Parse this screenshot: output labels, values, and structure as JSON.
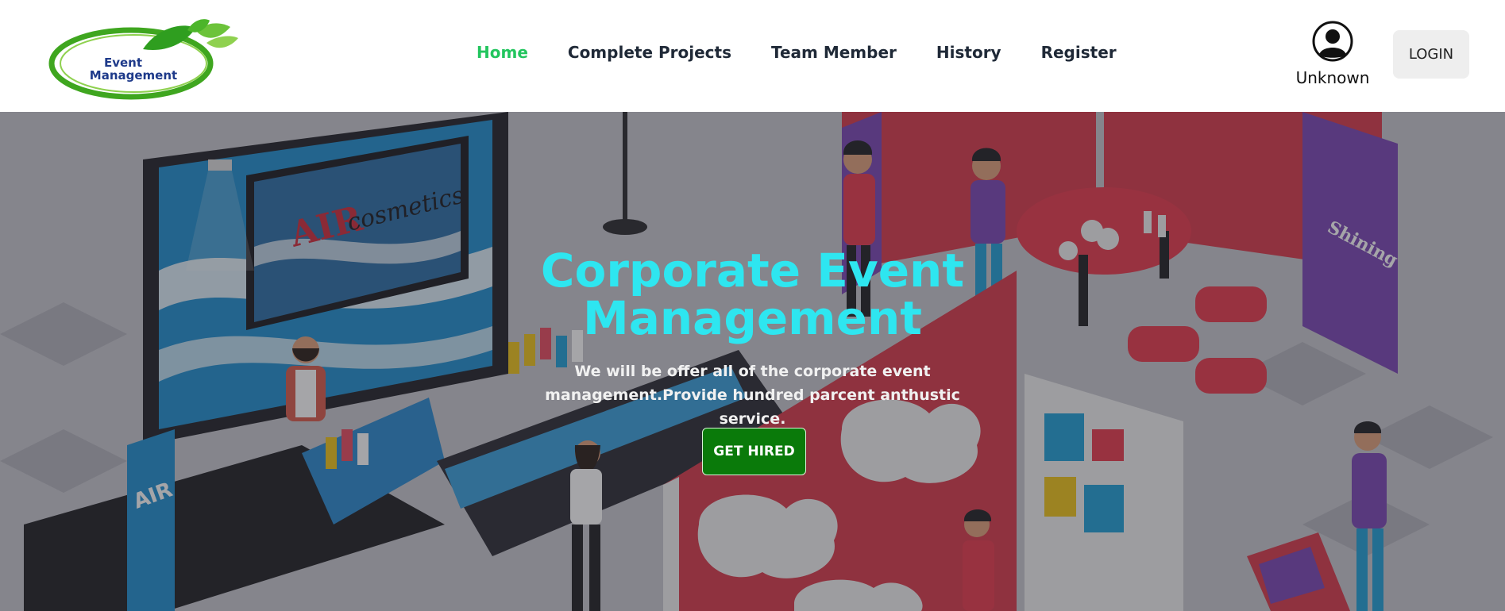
{
  "logo": {
    "line1": "Event",
    "line2": "Management"
  },
  "nav": {
    "items": [
      {
        "label": "Home",
        "active": true
      },
      {
        "label": "Complete Projects",
        "active": false
      },
      {
        "label": "Team Member",
        "active": false
      },
      {
        "label": "History",
        "active": false
      },
      {
        "label": "Register",
        "active": false
      }
    ]
  },
  "user": {
    "name": "Unknown",
    "icon": "user-avatar-icon"
  },
  "login": {
    "label": "LOGIN"
  },
  "hero": {
    "title": "Corporate Event Management",
    "subtitle": "We will be offer all of the corporate event management.Provide hundred parcent anthustic service.",
    "cta_label": "GET HIRED",
    "art_texts": {
      "booth_brand": "AIR",
      "booth_word": "cosmetics",
      "banner": "AIR",
      "sign": "Shining"
    }
  },
  "colors": {
    "accent_active": "#22c55e",
    "hero_title": "#2ee6f0",
    "cta_background": "#0a7a0a",
    "login_background": "#eeeeee"
  }
}
